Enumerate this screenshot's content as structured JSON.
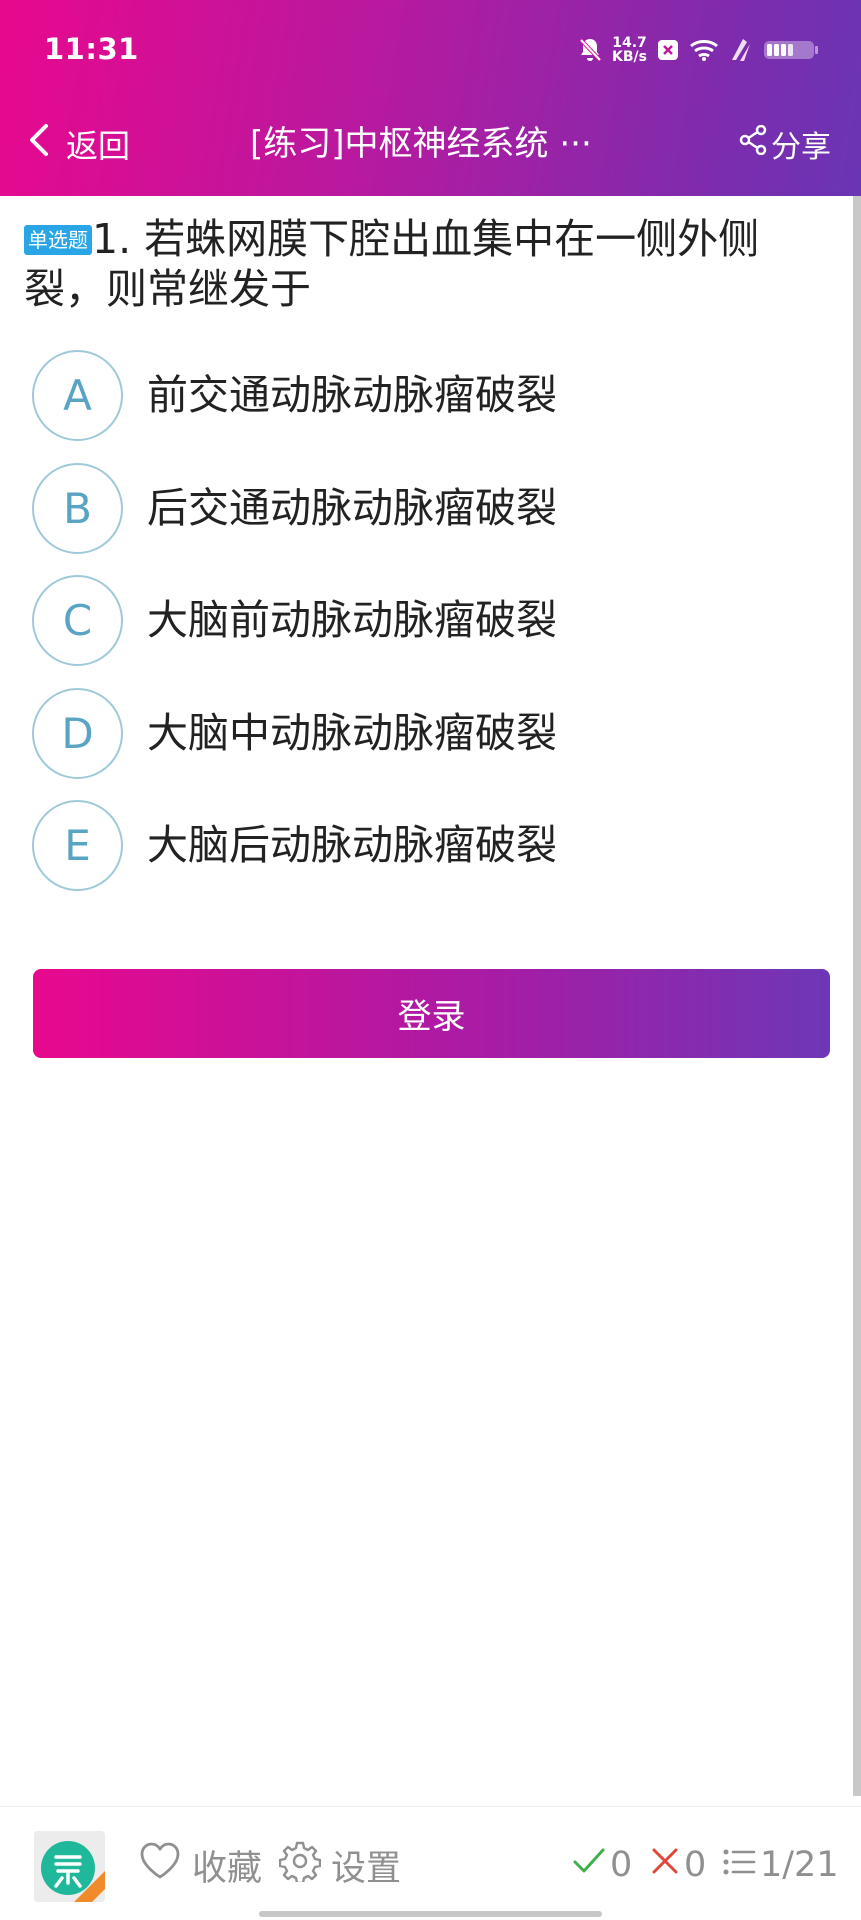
{
  "status_bar": {
    "time": "11:31",
    "net_speed_value": "14.7",
    "net_speed_unit": "KB/s",
    "icons": [
      "bell-off-icon",
      "close-box-icon",
      "wifi-icon",
      "flash-charge-icon",
      "battery-icon"
    ]
  },
  "nav": {
    "back_label": "返回",
    "title": "[练习]中枢神经系统 ···",
    "share_label": "分享"
  },
  "question": {
    "type_badge": "单选题",
    "text": "1. 若蛛网膜下腔出血集中在一侧外侧裂，则常继发于"
  },
  "options": [
    {
      "letter": "A",
      "text": "前交通动脉动脉瘤破裂"
    },
    {
      "letter": "B",
      "text": "后交通动脉动脉瘤破裂"
    },
    {
      "letter": "C",
      "text": "大脑前动脉动脉瘤破裂"
    },
    {
      "letter": "D",
      "text": "大脑中动脉动脉瘤破裂"
    },
    {
      "letter": "E",
      "text": "大脑后动脉动脉瘤破裂"
    }
  ],
  "login_button": "登录",
  "bottom_bar": {
    "favorite_label": "收藏",
    "settings_label": "设置",
    "correct_count": "0",
    "wrong_count": "0",
    "progress": "1/21"
  },
  "colors": {
    "header_gradient_start": "#e8088e",
    "header_gradient_end": "#6a35b4",
    "badge_blue": "#2aa6e6",
    "option_border": "#9fc9d8",
    "option_letter": "#5aa4c3",
    "correct_green": "#3fb04a",
    "wrong_red": "#e0473a"
  }
}
